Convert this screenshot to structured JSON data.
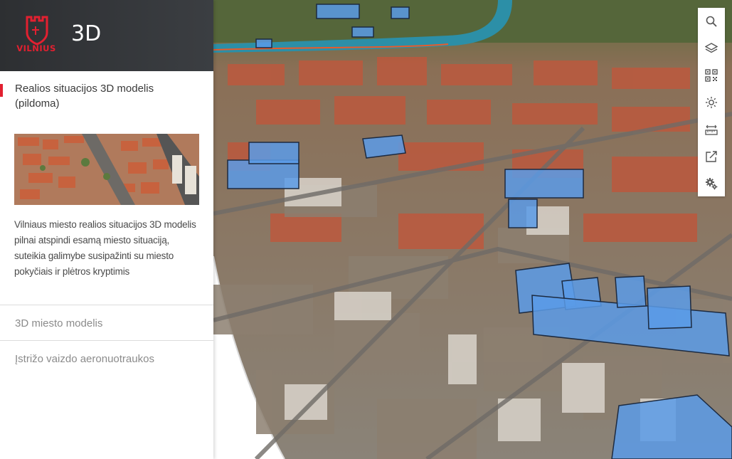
{
  "header": {
    "logo_text": "VILNIUS",
    "app_title": "3D"
  },
  "active_item": {
    "label": "Realios situacijos 3D modelis (pildoma)",
    "description": "Vilniaus miesto realios situacijos 3D modelis pilnai atspindi esamą miesto situaciją, suteikia galimybe susipažinti su miesto pokyčiais ir plėtros kryptimis"
  },
  "menu": [
    {
      "label": "3D miesto modelis"
    },
    {
      "label": "Įstrižo vaizdo aeronuotraukos"
    }
  ],
  "toolbar": [
    {
      "icon": "search-icon"
    },
    {
      "icon": "layers-icon"
    },
    {
      "icon": "qr-code-icon"
    },
    {
      "icon": "sun-icon"
    },
    {
      "icon": "measure-icon"
    },
    {
      "icon": "share-icon"
    },
    {
      "icon": "settings-icon"
    }
  ],
  "colors": {
    "accent": "#e22030",
    "header_bg": "#2d2f32",
    "highlight_building": "#5b9be8"
  }
}
